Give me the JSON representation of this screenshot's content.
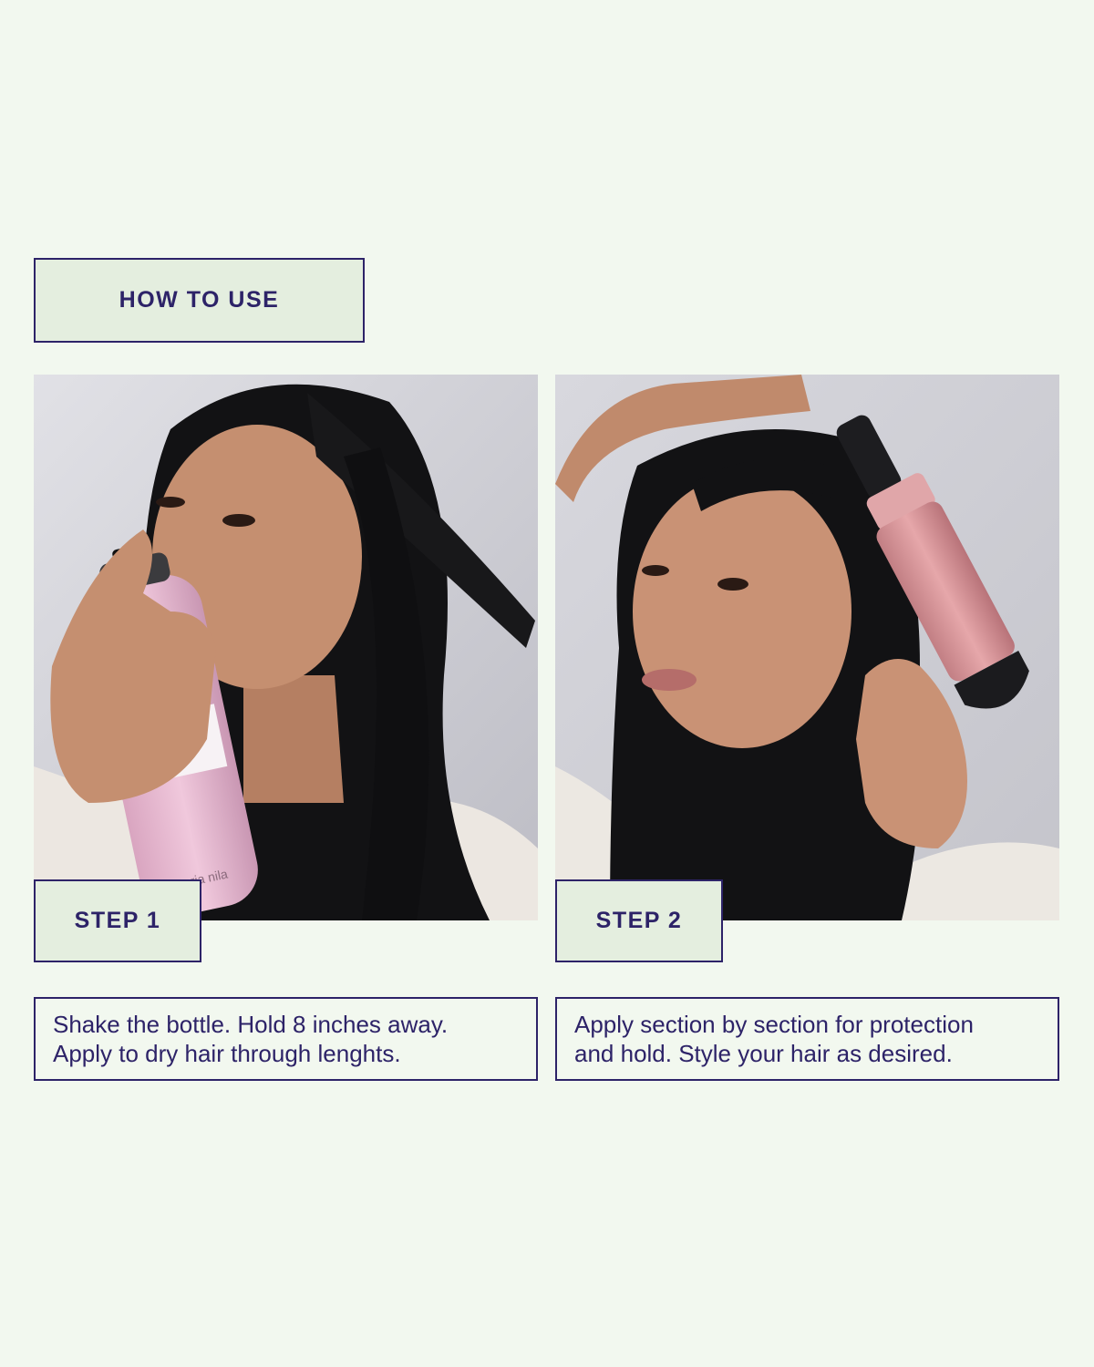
{
  "header": {
    "title": "HOW TO USE"
  },
  "steps": [
    {
      "label": "STEP 1",
      "photo_icon": "woman-spraying-product-photo",
      "product_text": "maria nila",
      "description_lines": [
        "Shake the bottle. Hold 8 inches away.",
        "Apply to dry hair through lenghts."
      ]
    },
    {
      "label": "STEP 2",
      "photo_icon": "woman-curling-hair-photo",
      "description_lines": [
        "Apply section by section for protection",
        "and hold. Style your hair as desired."
      ]
    }
  ],
  "colors": {
    "background": "#f2f8ef",
    "box_fill": "#e4eedf",
    "accent": "#2d2368",
    "product_pink": "#e8b9d2",
    "tool_rose": "#d68f92"
  }
}
